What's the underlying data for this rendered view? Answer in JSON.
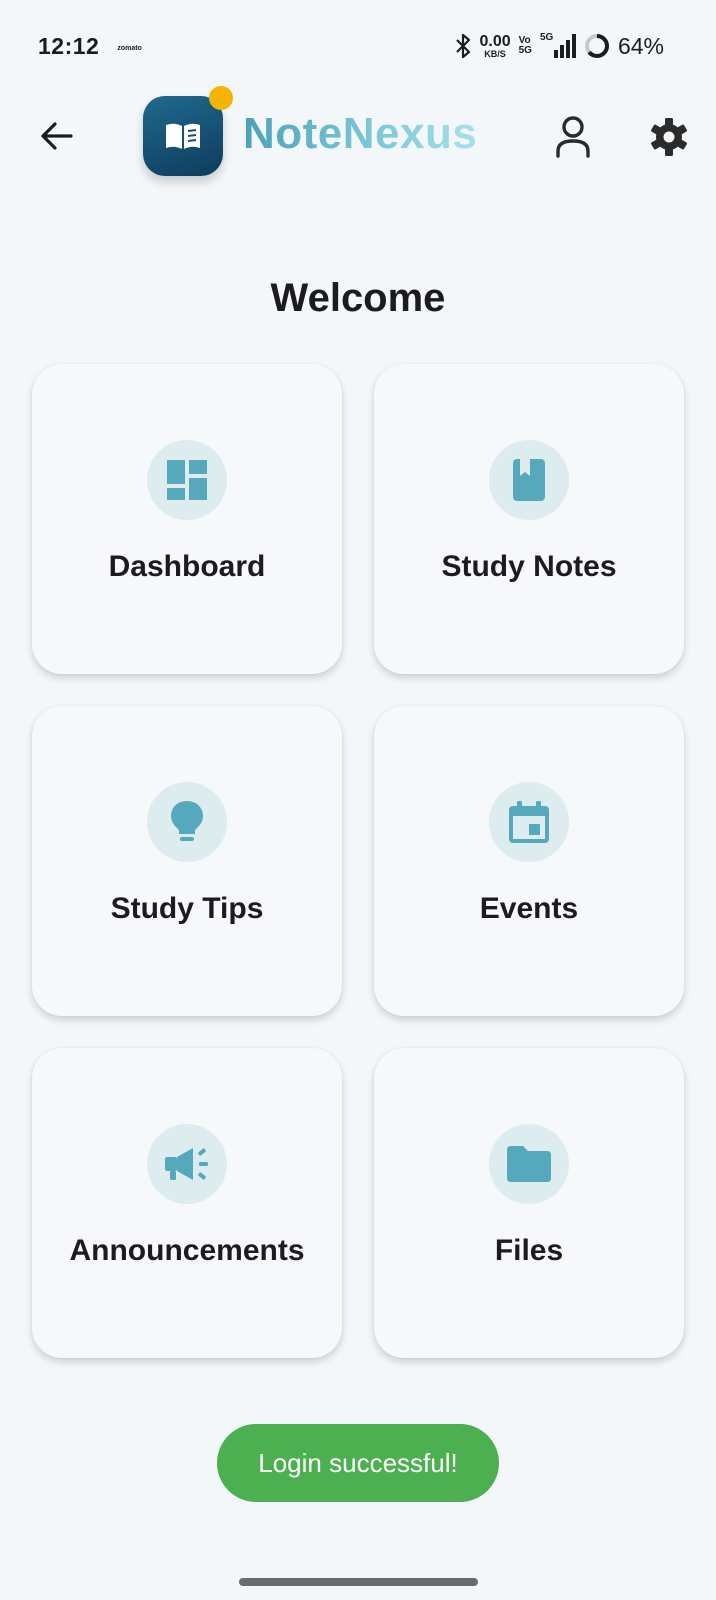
{
  "status_bar": {
    "time": "12:12",
    "notification_app": "zomato",
    "net_speed_value": "0.00",
    "net_speed_unit": "KB/S",
    "volte_top": "Vo",
    "volte_bottom": "5G",
    "network_type": "5G",
    "battery": "64%"
  },
  "header": {
    "app_name": "NoteNexus",
    "back_icon": "arrow-left-icon",
    "profile_icon": "person-outline-icon",
    "settings_icon": "gear-icon",
    "logo_icon": "open-book-icon",
    "notification_dot_color": "#f5b400"
  },
  "main": {
    "title": "Welcome",
    "accent_color": "#56a9bd",
    "cards": [
      {
        "label": "Dashboard",
        "icon": "dashboard-icon"
      },
      {
        "label": "Study Notes",
        "icon": "book-icon"
      },
      {
        "label": "Study Tips",
        "icon": "lightbulb-icon"
      },
      {
        "label": "Events",
        "icon": "calendar-icon"
      },
      {
        "label": "Announcements",
        "icon": "megaphone-icon"
      },
      {
        "label": "Files",
        "icon": "folder-icon"
      }
    ]
  },
  "toast": {
    "message": "Login successful!",
    "color": "#4caf50"
  }
}
